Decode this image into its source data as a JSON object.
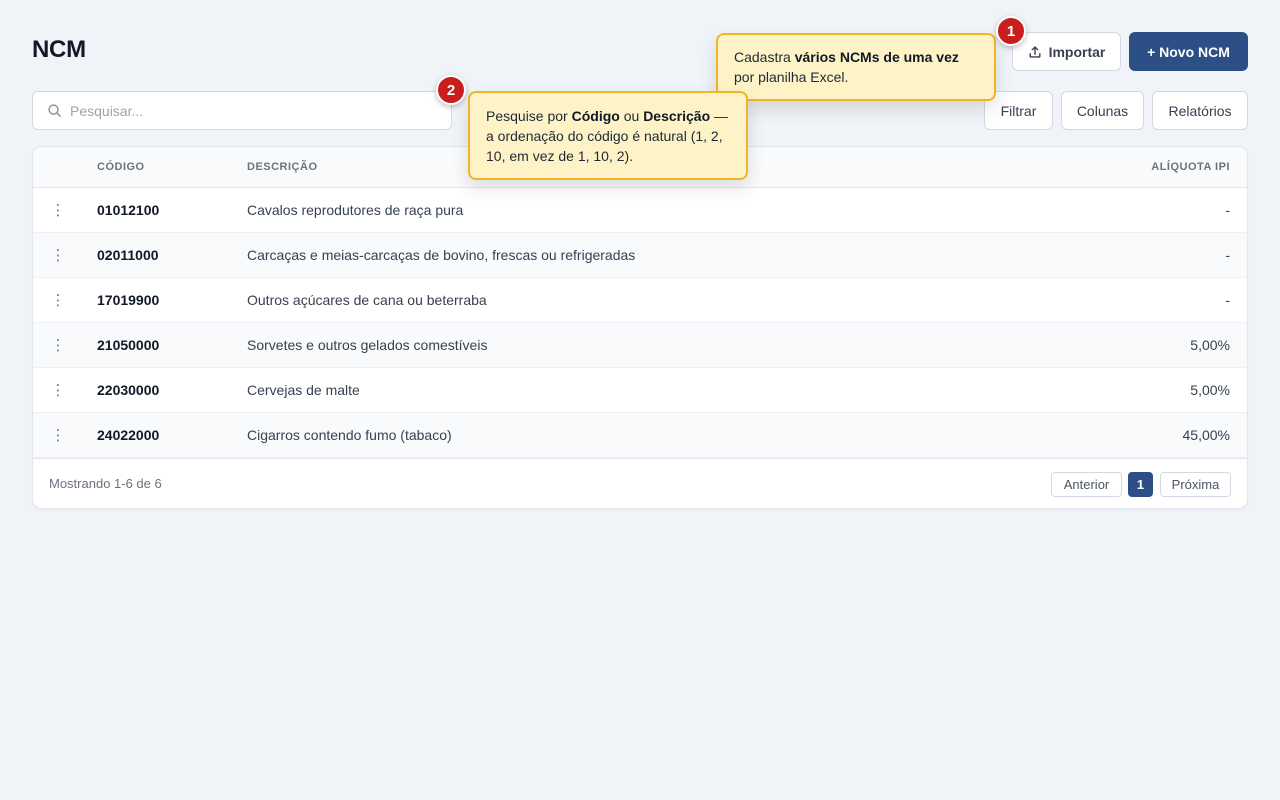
{
  "page": {
    "title": "NCM"
  },
  "toolbar": {
    "import_label": "Importar",
    "import_icon": "upload-icon",
    "new_label": "+ Novo NCM",
    "filter_label": "Filtrar",
    "columns_label": "Colunas",
    "reports_label": "Relatórios",
    "primary_color": "#2c4f85"
  },
  "search": {
    "placeholder": "Pesquisar...",
    "value": "",
    "icon": "search-icon"
  },
  "table": {
    "columns": {
      "code": "CÓDIGO",
      "description": "DESCRIÇÃO",
      "ipi": "ALÍQUOTA IPI"
    },
    "row_menu_icon": "vertical-dots-icon",
    "rows": [
      {
        "code": "01012100",
        "description": "Cavalos reprodutores de raça pura",
        "ipi": "-"
      },
      {
        "code": "02011000",
        "description": "Carcaças e meias-carcaças de bovino, frescas ou refrigeradas",
        "ipi": "-"
      },
      {
        "code": "17019900",
        "description": "Outros açúcares de cana ou beterraba",
        "ipi": "-"
      },
      {
        "code": "21050000",
        "description": "Sorvetes e outros gelados comestíveis",
        "ipi": "5,00%"
      },
      {
        "code": "22030000",
        "description": "Cervejas de malte",
        "ipi": "5,00%"
      },
      {
        "code": "24022000",
        "description": "Cigarros contendo fumo (tabaco)",
        "ipi": "45,00%"
      }
    ]
  },
  "pagination": {
    "summary": "Mostrando 1-6 de 6",
    "prev_label": "Anterior",
    "current_page": "1",
    "next_label": "Próxima"
  },
  "tooltips": [
    {
      "badge": "1",
      "parts": [
        {
          "text": "Cadastra ",
          "bold": false
        },
        {
          "text": "vários NCMs de uma vez",
          "bold": true
        },
        {
          "text": " por planilha Excel.",
          "bold": false
        }
      ]
    },
    {
      "badge": "2",
      "parts": [
        {
          "text": "Pesquise por ",
          "bold": false
        },
        {
          "text": "Código",
          "bold": true
        },
        {
          "text": " ou ",
          "bold": false
        },
        {
          "text": "Descrição",
          "bold": true
        },
        {
          "text": " — a ordenação do código é natural (1, 2, 10, em vez de 1, 10, 2).",
          "bold": false
        }
      ]
    }
  ],
  "colors": {
    "tooltip_bg": "#fef3c7",
    "tooltip_border": "#f0b429",
    "badge": "#c81e1e",
    "page_bg": "#f0f3f7"
  }
}
